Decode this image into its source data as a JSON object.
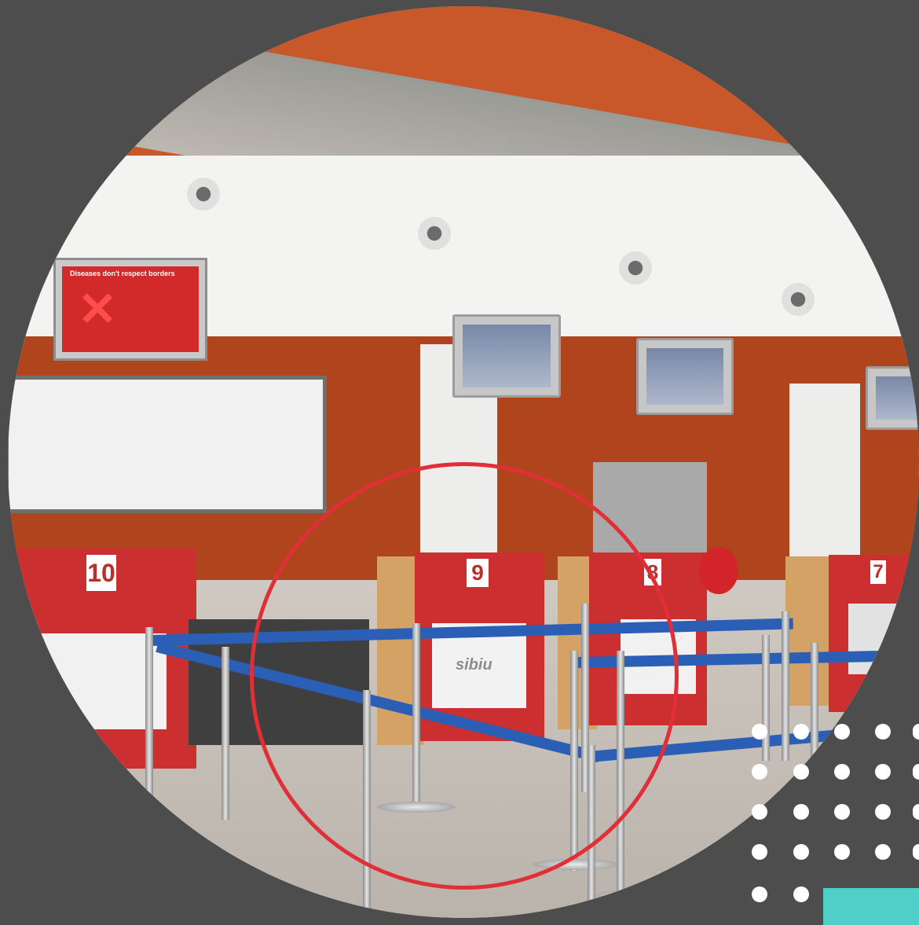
{
  "photo": {
    "description_icon": "airport-check-in-photo",
    "desk_numbers": [
      "10",
      "9",
      "8",
      "7"
    ],
    "sign_logo": "sibiu",
    "ad_headline": "Diseases don't respect borders"
  },
  "colors": {
    "background": "#4d4d4d",
    "highlight_ring": "#e02f36",
    "accent_block": "#50cfc8",
    "dot": "#ffffff"
  }
}
